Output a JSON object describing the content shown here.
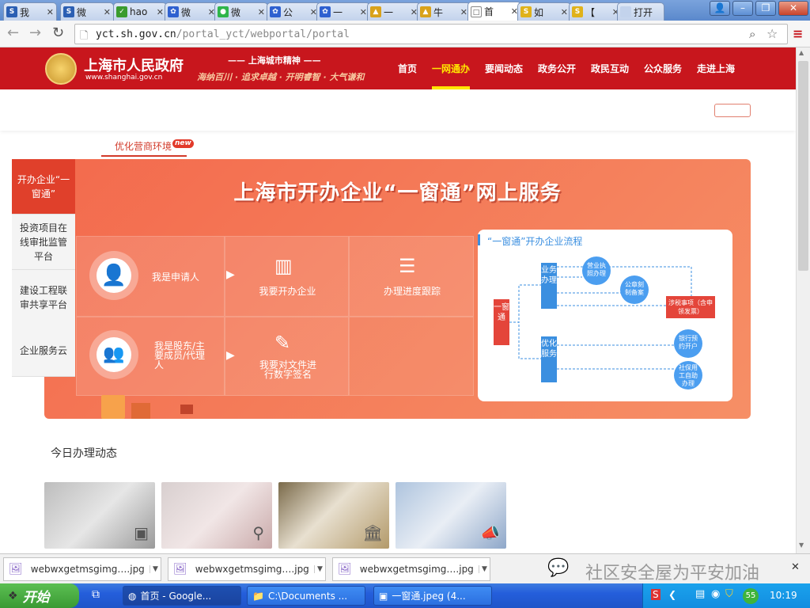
{
  "browser": {
    "tabs": [
      {
        "title": "我",
        "icon": "S",
        "color": "#2b5fb3"
      },
      {
        "title": "微",
        "icon": "S",
        "color": "#2b5fb3"
      },
      {
        "title": "hao",
        "icon": "✓",
        "color": "#3a9b2e"
      },
      {
        "title": "微",
        "icon": "✿",
        "color": "#2f61d0"
      },
      {
        "title": "微",
        "icon": "●",
        "color": "#2fb54a"
      },
      {
        "title": "公",
        "icon": "✿",
        "color": "#2f61d0"
      },
      {
        "title": "一",
        "icon": "✿",
        "color": "#2f61d0"
      },
      {
        "title": "一",
        "icon": "▲",
        "color": "#d9a21a"
      },
      {
        "title": "牛",
        "icon": "▲",
        "color": "#d9a21a"
      },
      {
        "title": "首",
        "icon": "□",
        "color": "#ffffff"
      },
      {
        "title": "如",
        "icon": "S",
        "color": "#e0b21a"
      },
      {
        "title": "【",
        "icon": "S",
        "color": "#e0b21a"
      },
      {
        "title": "打开",
        "icon": "",
        "color": "#c3d3ec"
      }
    ],
    "url_host": "yct.sh.gov.cn",
    "url_path": "/portal_yct/webportal/portal"
  },
  "site": {
    "logo_title": "上海市人民政府",
    "logo_url": "www.shanghai.gov.cn",
    "spirit_title": "上海城市精神",
    "spirit_text": "海纳百川 · 追求卓越 · 开明睿智 · 大气谦和",
    "nav": [
      "首页",
      "一网通办",
      "要闻动态",
      "政务公开",
      "政民互动",
      "公众服务",
      "走进上海"
    ],
    "nav_active": "一网通办"
  },
  "main": {
    "optimize_label": "优化营商环境",
    "new_badge": "new",
    "banner_title": "上海市开办企业“一窗通”网上服务",
    "side_tabs": [
      "开办企业“一窗通”",
      "投资项目在线审批监管平台",
      "建设工程联审共享平台",
      "企业服务云"
    ],
    "applicant": "我是申请人",
    "shareholder": "我是股东/主要成员/代理人",
    "open_company": "我要开办企业",
    "progress": "办理进度跟踪",
    "sign_docs": "我要对文件进行数字签名",
    "flow_title": "“一窗通”开办企业流程",
    "flow": {
      "window": "一窗通",
      "business": "业务办理",
      "optimize": "优化服务",
      "license": "营业执照办理",
      "seal": "公章刻制备案",
      "tax": "涉税事项（含申领发票）",
      "bank": "银行预约开户",
      "social": "社保用工自助办理"
    },
    "today_title": "今日办理动态"
  },
  "downloads": [
    {
      "name": "webwxgetmsgimg….jpg"
    },
    {
      "name": "webwxgetmsgimg….jpg"
    },
    {
      "name": "webwxgetmsgimg….jpg"
    }
  ],
  "watermark": "社区安全屋为平安加油",
  "taskbar": {
    "start": "开始",
    "tasks": [
      "首页 - Google...",
      "C:\\Documents ...",
      "一窗通.jpeg (4..."
    ],
    "clock": "10:19",
    "tray_badge": "55"
  }
}
